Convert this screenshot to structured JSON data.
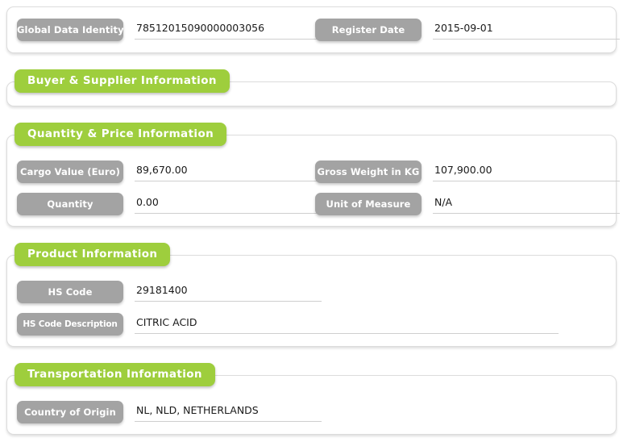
{
  "sections": [
    {
      "id": "header",
      "title": null,
      "fields": [
        {
          "label": "Global Data Identity",
          "value": "78512015090000003056",
          "width": "half"
        },
        {
          "label": "Register Date",
          "value": "2015-09-01",
          "width": "half"
        }
      ]
    },
    {
      "id": "buyer-supplier",
      "title": "Buyer & Supplier Information",
      "fields": []
    },
    {
      "id": "quantity-price",
      "title": "Quantity & Price Information",
      "fields": [
        {
          "label": "Cargo Value (Euro)",
          "value": "89,670.00",
          "width": "half"
        },
        {
          "label": "Gross Weight in KG",
          "value": "107,900.00",
          "width": "half"
        },
        {
          "label": "Quantity",
          "value": "0.00",
          "width": "half"
        },
        {
          "label": "Unit of Measure",
          "value": "N/A",
          "width": "half"
        }
      ]
    },
    {
      "id": "product",
      "title": "Product Information",
      "fields": [
        {
          "label": "HS Code",
          "value": "29181400",
          "width": "half"
        },
        {
          "label": "HS Code Description",
          "value": "CITRIC ACID",
          "width": "wide"
        }
      ]
    },
    {
      "id": "transportation",
      "title": "Transportation Information",
      "fields": [
        {
          "label": "Country of Origin",
          "value": "NL, NLD, NETHERLANDS",
          "width": "half"
        }
      ]
    }
  ],
  "colors": {
    "section_green": "#9ece3d",
    "label_gray": "#a3a3a3",
    "panel_border": "#dcdcdc",
    "underline": "#cfcfcf",
    "value_text": "#1a1a1a",
    "badge_text": "#ffffff"
  }
}
